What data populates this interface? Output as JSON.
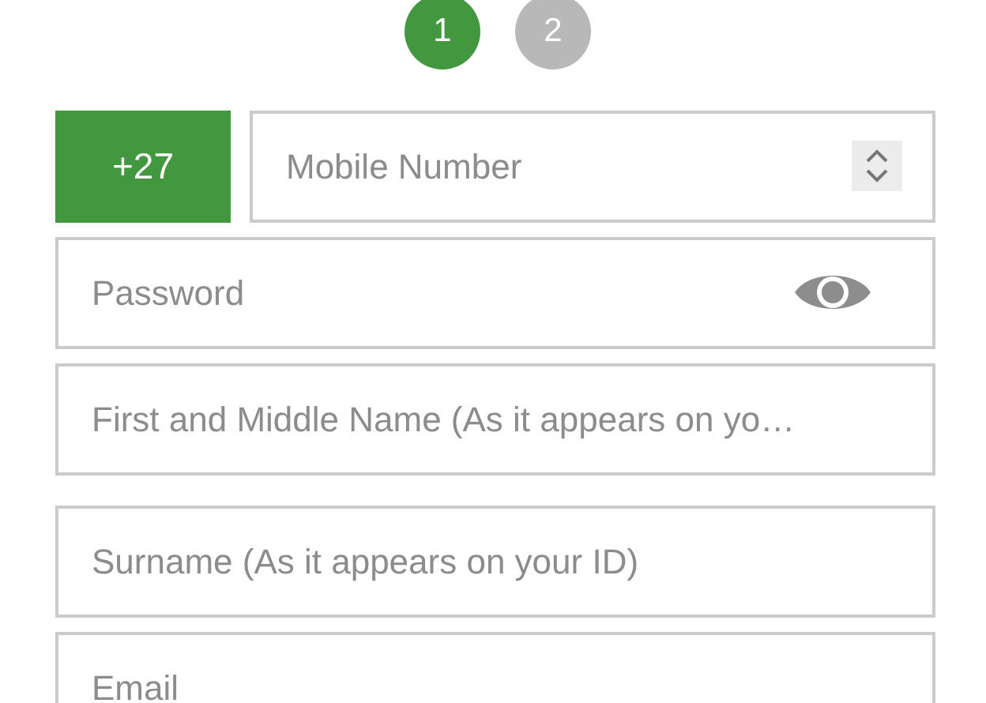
{
  "steps": [
    {
      "label": "1",
      "selected": true
    },
    {
      "label": "2",
      "selected": false
    }
  ],
  "mobile": {
    "country_code": "+27",
    "placeholder": "Mobile Number"
  },
  "password": {
    "placeholder": "Password"
  },
  "fields": [
    {
      "placeholder": "First and Middle Name (As it appears on yo…"
    },
    {
      "placeholder": "Surname (As it appears on your ID)"
    },
    {
      "placeholder": "Email"
    }
  ]
}
